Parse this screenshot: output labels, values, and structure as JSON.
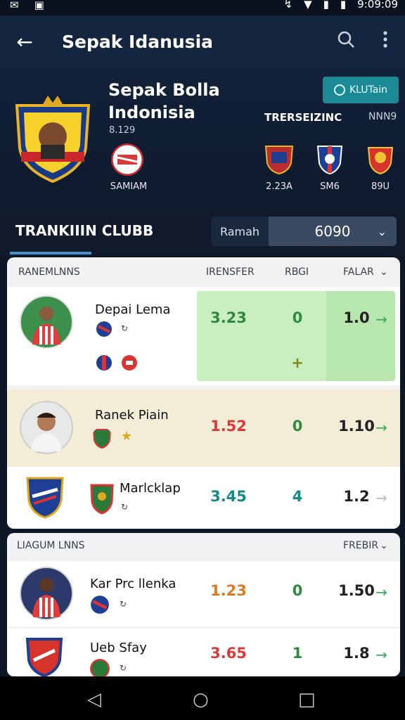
{
  "status": {
    "time": "9:09:09"
  },
  "appbar": {
    "title": "Sepak Idanusia"
  },
  "hero": {
    "club_name": "Sepak Bolla Indonisia",
    "sub": "8.129",
    "follow_label": "KLUTain",
    "trending_label": "TRERSEIZINC",
    "trending_label2": "NNN9",
    "left_club_label": "SAMIAM",
    "trend_clubs": [
      {
        "label": "2.23A"
      },
      {
        "label": "SM6"
      },
      {
        "label": "89U"
      }
    ]
  },
  "tabs": {
    "active_tab": "TRANKIIIN CLUBB",
    "filter_label": "Ramah",
    "select_value": "6090"
  },
  "section1": {
    "header": "RANEMLNNS",
    "col_transfer": "IRENSFER",
    "col_rebi": "RBGI",
    "col_falar": "FALAR",
    "rows": [
      {
        "name": "Depai Lema",
        "v1": "3.23",
        "v2": "0",
        "v3": "1.0",
        "extra": "+"
      },
      {
        "name": "Ranek Piain",
        "v1": "1.52",
        "v2": "0",
        "v3": "1.10"
      },
      {
        "name": "Marlcklap",
        "v1": "3.45",
        "v2": "4",
        "v3": "1.2"
      }
    ]
  },
  "section2": {
    "header": "LIAGUM LNNS",
    "col_frebir": "FREBIR",
    "rows": [
      {
        "name": "Kar Prc llenka",
        "v1": "1.23",
        "v2": "0",
        "v3": "1.50"
      },
      {
        "name": "Ueb Sfay",
        "v1": "3.65",
        "v2": "1",
        "v3": "1.8"
      }
    ]
  },
  "colors": {
    "green": "#3aa85a",
    "red": "#d93a3a",
    "teal": "#1b8a96",
    "orange": "#e07a1f"
  }
}
